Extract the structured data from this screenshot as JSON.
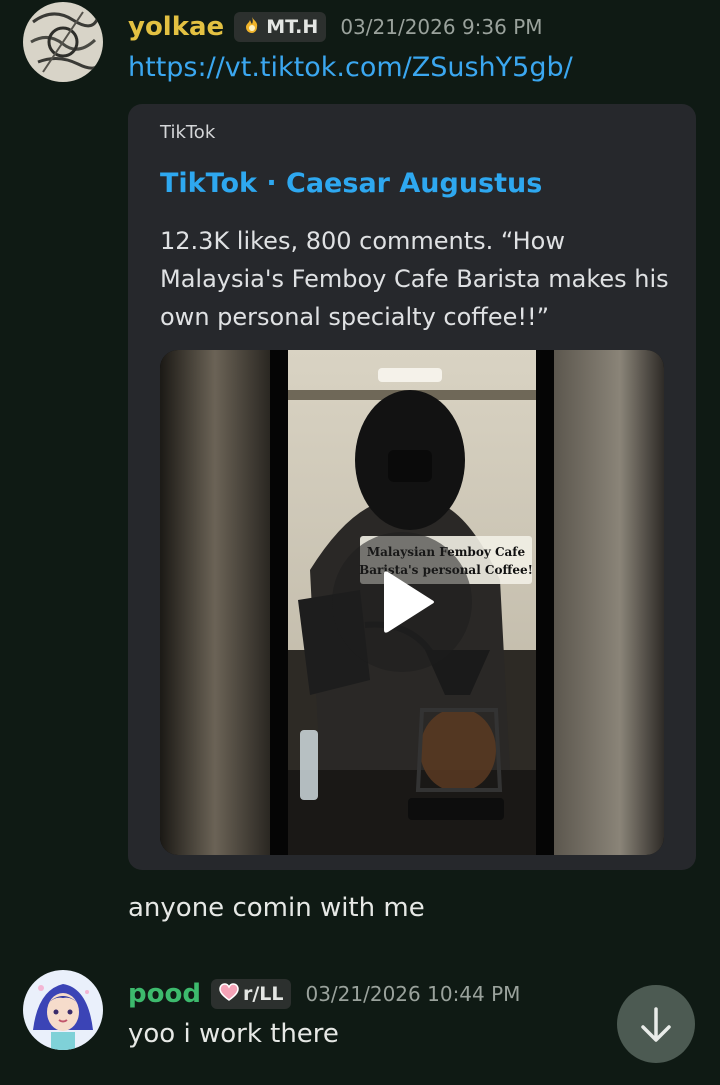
{
  "messages": [
    {
      "author": "yolkae",
      "author_color": "#e3c142",
      "tag_icon": "flame-badge-icon",
      "tag": "MT.H",
      "timestamp": "03/21/2026 9:36 PM",
      "link": "https://vt.tiktok.com/ZSushY5gb/",
      "embed": {
        "provider": "TikTok",
        "title": "TikTok · Caesar Augustus",
        "description": "12.3K likes, 800 comments. “How Malaysia's Femboy Cafe Barista makes his own personal specialty coffee!!”",
        "media_caption_line1": "Malaysian Femboy Cafe",
        "media_caption_line2": "Barista's personal Coffee!"
      }
    },
    {
      "text": "anyone comin with me"
    },
    {
      "author": "pood",
      "author_color": "#3dba6d",
      "tag_icon": "heart-icon",
      "tag": "r/LL",
      "timestamp": "03/21/2026 10:44 PM",
      "text": "yoo i work there"
    }
  ],
  "jump_to_bottom_icon": "arrow-down-icon"
}
